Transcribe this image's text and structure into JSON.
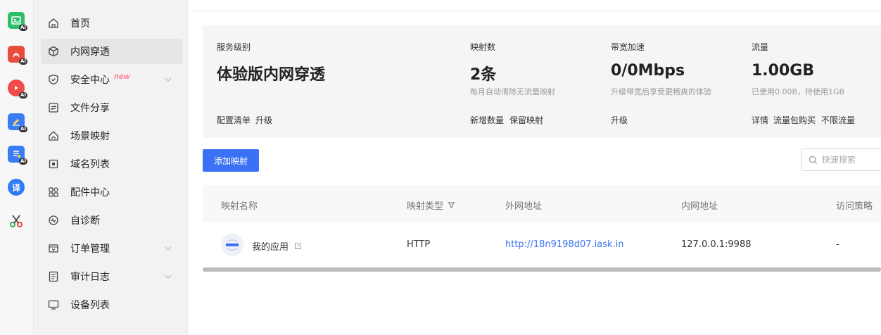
{
  "app_rail": {
    "items": [
      {
        "icon": "ai-image-icon",
        "color": "#2ebd6b",
        "badge": "AI"
      },
      {
        "icon": "ai-pdf-icon",
        "color": "#e94b3c",
        "badge": "AI"
      },
      {
        "icon": "ai-video-icon",
        "color": "#f04a4a",
        "badge": "AI"
      },
      {
        "icon": "ai-edit-icon",
        "color": "#3a7cf5",
        "badge": "AI"
      },
      {
        "icon": "ai-document-icon",
        "color": "#3a7cf5",
        "badge": "AI"
      },
      {
        "icon": "translate-icon",
        "color": "#2f7cf5",
        "glyph": "译"
      },
      {
        "icon": "scissors-icon",
        "color": "#3aa65c"
      }
    ]
  },
  "sidebar": {
    "items": [
      {
        "label": "首页",
        "icon": "home-icon"
      },
      {
        "label": "内网穿透",
        "icon": "cube-icon",
        "active": true
      },
      {
        "label": "安全中心",
        "icon": "shield-icon",
        "badge": "new",
        "expandable": true
      },
      {
        "label": "文件分享",
        "icon": "file-share-icon"
      },
      {
        "label": "场景映射",
        "icon": "scene-icon"
      },
      {
        "label": "域名列表",
        "icon": "domain-icon"
      },
      {
        "label": "配件中心",
        "icon": "grid-icon"
      },
      {
        "label": "自诊断",
        "icon": "diagnose-icon"
      },
      {
        "label": "订单管理",
        "icon": "order-icon",
        "expandable": true
      },
      {
        "label": "审计日志",
        "icon": "log-icon",
        "expandable": true
      },
      {
        "label": "设备列表",
        "icon": "device-icon"
      }
    ]
  },
  "summary": {
    "service": {
      "label": "服务级别",
      "value": "体验版内网穿透",
      "links": [
        "配置清单",
        "升级"
      ]
    },
    "mappings": {
      "label": "映射数",
      "value": "2条",
      "note": "每月自动清除无流量映射",
      "links": [
        "新增数量",
        "保留映射"
      ]
    },
    "bandwidth": {
      "label": "带宽加速",
      "value": "0/0Mbps",
      "note": "升级带宽后享受更畅爽的体验",
      "links": [
        "升级"
      ]
    },
    "traffic": {
      "label": "流量",
      "value": "1.00GB",
      "note": "已使用0.00B，待使用1GB",
      "links": [
        "详情",
        "流量包购买",
        "不限流量"
      ]
    }
  },
  "toolbar": {
    "add_label": "添加映射",
    "search_placeholder": "快速搜索"
  },
  "table": {
    "columns": [
      "映射名称",
      "映射类型",
      "外网地址",
      "内网地址",
      "访问策略"
    ],
    "rows": [
      {
        "name": "我的应用",
        "type": "HTTP",
        "external": "http://18n9198d07.iask.in",
        "internal": "127.0.0.1:9988",
        "policy": "-"
      }
    ]
  },
  "colors": {
    "accent": "#3b72f5",
    "new_badge": "#ff4d6a"
  }
}
